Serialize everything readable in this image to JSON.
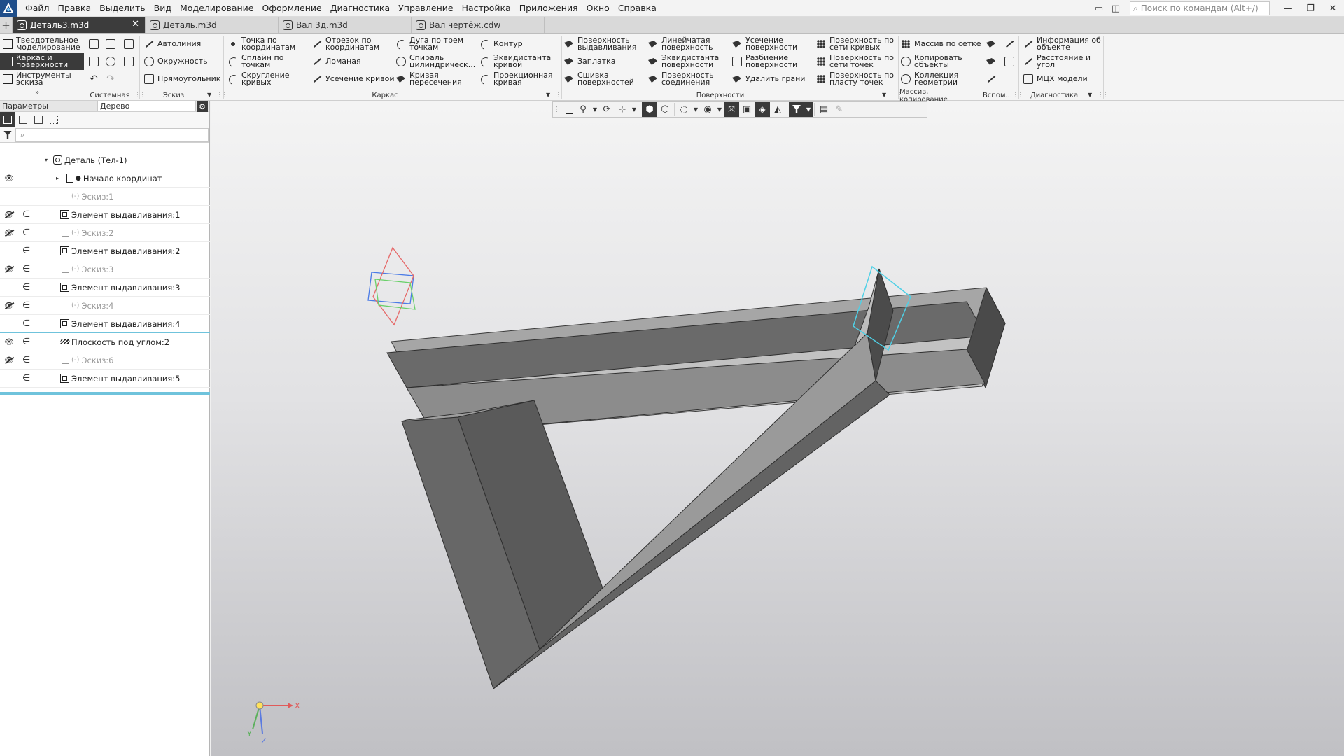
{
  "menubar": {
    "items": [
      "Файл",
      "Правка",
      "Выделить",
      "Вид",
      "Моделирование",
      "Оформление",
      "Диагностика",
      "Управление",
      "Настройка",
      "Приложения",
      "Окно",
      "Справка"
    ],
    "search_placeholder": "Поиск по командам (Alt+/)"
  },
  "tabs": [
    {
      "label": "Деталь3.m3d",
      "active": true
    },
    {
      "label": "Деталь.m3d"
    },
    {
      "label": "Вал 3д.m3d"
    },
    {
      "label": "Вал чертёж.cdw"
    }
  ],
  "ribbon": {
    "modes": [
      "Твердотельное моделирование",
      "Каркас и поверхности",
      "Инструменты эскиза"
    ],
    "sketch": [
      "Автолиния",
      "Окружность",
      "Прямоугольник"
    ],
    "frame_col1": [
      "Точка по координатам",
      "Сплайн по точкам",
      "Скругление кривых"
    ],
    "frame_col2": [
      "Отрезок по координатам",
      "Ломаная",
      "Усечение кривой"
    ],
    "frame_col3": [
      "Дуга по трем точкам",
      "Спираль цилиндрическ...",
      "Кривая пересечения"
    ],
    "frame_col4": [
      "Контур",
      "Эквидистанта кривой",
      "Проекционная кривая"
    ],
    "surf_col1": [
      "Поверхность выдавливания",
      "Заплатка",
      "Сшивка поверхностей"
    ],
    "surf_col2": [
      "Линейчатая поверхность",
      "Эквидистанта поверхности",
      "Поверхность соединения"
    ],
    "surf_col3": [
      "Усечение поверхности",
      "Разбиение поверхности",
      "Удалить грани"
    ],
    "surf_col4": [
      "Поверхность по сети кривых",
      "Поверхность по сети точек",
      "Поверхность по пласту точек"
    ],
    "array": [
      "Массив по сетке",
      "Копировать объекты",
      "Коллекция геометрии"
    ],
    "diag": [
      "Информация об объекте",
      "Расстояние и угол",
      "МЦХ модели"
    ],
    "groups": {
      "system": "Системная",
      "sketch": "Эскиз",
      "frame": "Каркас",
      "surfaces": "Поверхности",
      "array": "Массив, копирование",
      "aux": "Вспом...",
      "diag": "Диагностика"
    }
  },
  "panel": {
    "tabs": [
      "Параметры",
      "Дерево"
    ],
    "search_placeholder": "⌕"
  },
  "tree": [
    {
      "label": "Деталь (Тел-1)",
      "icon": "part",
      "level": 0,
      "eye": "",
      "member": false,
      "expander": "▾",
      "dim": false
    },
    {
      "label": "Начало координат",
      "icon": "axis",
      "level": 1,
      "eye": "on",
      "member": false,
      "expander": "▸",
      "dim": false,
      "bullet": "●"
    },
    {
      "label": "Эскиз:1",
      "icon": "sketch",
      "level": 1,
      "eye": "",
      "member": false,
      "dim": true,
      "state": "(-)"
    },
    {
      "label": "Элемент выдавливания:1",
      "icon": "extrude",
      "level": 1,
      "eye": "off",
      "member": true,
      "dim": false
    },
    {
      "label": "Эскиз:2",
      "icon": "sketch",
      "level": 1,
      "eye": "off",
      "member": true,
      "dim": true,
      "state": "(-)"
    },
    {
      "label": "Элемент выдавливания:2",
      "icon": "extrude",
      "level": 1,
      "eye": "",
      "member": true,
      "dim": false
    },
    {
      "label": "Эскиз:3",
      "icon": "sketch",
      "level": 1,
      "eye": "off",
      "member": true,
      "dim": true,
      "state": "(-)"
    },
    {
      "label": "Элемент выдавливания:3",
      "icon": "extrude",
      "level": 1,
      "eye": "",
      "member": true,
      "dim": false
    },
    {
      "label": "Эскиз:4",
      "icon": "sketch",
      "level": 1,
      "eye": "off",
      "member": true,
      "dim": true,
      "state": "(-)"
    },
    {
      "label": "Элемент выдавливания:4",
      "icon": "extrude",
      "level": 1,
      "eye": "",
      "member": true,
      "dim": false,
      "highlight": true
    },
    {
      "label": "Плоскость под углом:2",
      "icon": "plane",
      "level": 1,
      "eye": "on",
      "member": true,
      "dim": false
    },
    {
      "label": "Эскиз:6",
      "icon": "sketch",
      "level": 1,
      "eye": "off",
      "member": true,
      "dim": true,
      "state": "(-)"
    },
    {
      "label": "Элемент выдавливания:5",
      "icon": "extrude",
      "level": 1,
      "eye": "",
      "member": true,
      "dim": false
    }
  ],
  "triad": {
    "x": "X",
    "y": "Y",
    "z": "Z"
  },
  "colors": {
    "accent": "#1f4e8a",
    "selection": "#4fd0e6",
    "dark_tab": "#3c3c3c",
    "tree_highlight": "#6fc3dc"
  },
  "icons": [
    "app-logo-icon",
    "search-icon",
    "gear-icon",
    "filter-icon",
    "eye-icon",
    "eye-off-icon",
    "member-icon",
    "close-icon",
    "plus-icon"
  ]
}
